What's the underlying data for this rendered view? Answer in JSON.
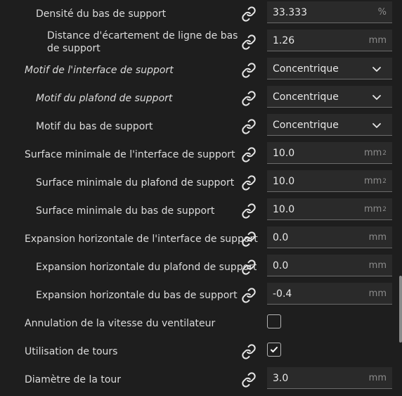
{
  "settings": [
    {
      "label": "Densité du bas de support",
      "indent": 51,
      "italic": false,
      "value": "33.333",
      "unit": "%",
      "sup": "",
      "type": "number",
      "link": true
    },
    {
      "label": "Distance d'écartement de ligne de bas de support",
      "indent": 67,
      "italic": false,
      "value": "1.26",
      "unit": "mm",
      "sup": "",
      "type": "number",
      "link": true,
      "multiline": true
    },
    {
      "label": "Motif de l'interface de support",
      "indent": 35,
      "italic": true,
      "value": "Concentrique",
      "type": "dropdown",
      "link": true
    },
    {
      "label": "Motif du plafond de support",
      "indent": 51,
      "italic": true,
      "value": "Concentrique",
      "type": "dropdown",
      "link": true
    },
    {
      "label": "Motif du bas de support",
      "indent": 51,
      "italic": false,
      "value": "Concentrique",
      "type": "dropdown",
      "link": true
    },
    {
      "label": "Surface minimale de l'interface de support",
      "indent": 35,
      "italic": false,
      "value": "10.0",
      "unit": "mm",
      "sup": "2",
      "type": "number",
      "link": true
    },
    {
      "label": "Surface minimale du plafond de support",
      "indent": 51,
      "italic": false,
      "value": "10.0",
      "unit": "mm",
      "sup": "2",
      "type": "number",
      "link": true
    },
    {
      "label": "Surface minimale du bas de support",
      "indent": 51,
      "italic": false,
      "value": "10.0",
      "unit": "mm",
      "sup": "2",
      "type": "number",
      "link": true
    },
    {
      "label": "Expansion horizontale de l'interface de support",
      "indent": 35,
      "italic": false,
      "value": "0.0",
      "unit": "mm",
      "sup": "",
      "type": "number",
      "link": true
    },
    {
      "label": "Expansion horizontale du plafond de support",
      "indent": 51,
      "italic": false,
      "value": "0.0",
      "unit": "mm",
      "sup": "",
      "type": "number",
      "link": true
    },
    {
      "label": "Expansion horizontale du bas de support",
      "indent": 51,
      "italic": false,
      "value": "-0.4",
      "unit": "mm",
      "sup": "",
      "type": "number",
      "link": true
    },
    {
      "label": "Annulation de la vitesse du ventilateur",
      "indent": 35,
      "italic": false,
      "type": "checkbox",
      "checked": false,
      "link": false
    },
    {
      "label": "Utilisation de tours",
      "indent": 35,
      "italic": false,
      "type": "checkbox",
      "checked": true,
      "link": true
    },
    {
      "label": "Diamètre de la tour",
      "indent": 35,
      "italic": false,
      "value": "3.0",
      "unit": "mm",
      "sup": "",
      "type": "number",
      "link": true
    }
  ],
  "icons": {
    "link": "link-icon",
    "dropdown": "chevron-down-icon",
    "check": "checkmark-icon"
  },
  "colors": {
    "background": "#1e1e1e",
    "field": "#2a2a2a",
    "text": "#dcdcdc",
    "unit": "#8c8c8c"
  }
}
